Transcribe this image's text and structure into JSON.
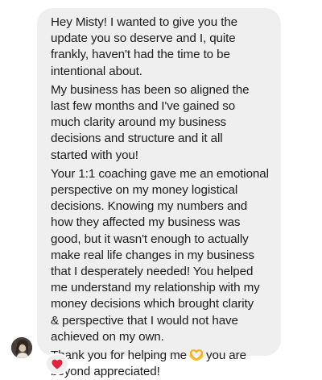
{
  "message": {
    "paragraphs": [
      "Hey Misty! I wanted to give you the\nupdate you so deserve and I, quite\nfrankly, haven't had the time to be\nintentional about.",
      "My business has been so aligned the\nlast few months and I've gained so\nmuch clarity around my business\ndecisions and structure and it all\nstarted with you!",
      "Your 1:1 coaching gave me an emotional\nperspective on my money logistical\ndecisions. Knowing my numbers and\nhow they affected my business was\ngood, but it wasn't enough to actually\nmake real life changes in my business\nthat I desperately needed! You helped\nme understand my relationship with my\nmoney decisions which brought clarity\n& perspective that I would not have\nachieved on my own."
    ],
    "closing_before_emoji": "Thank you for helping me",
    "closing_after_emoji": "you are\nbeyond appreciated!",
    "emoji_icon": "heart-hands-emoji"
  },
  "reaction": {
    "icon": "heart-icon",
    "color": "#e0243b"
  },
  "avatar": {
    "icon": "sender-avatar"
  },
  "colors": {
    "bubble": "#efefef",
    "text": "#1c1c1c",
    "background": "#ffffff"
  }
}
